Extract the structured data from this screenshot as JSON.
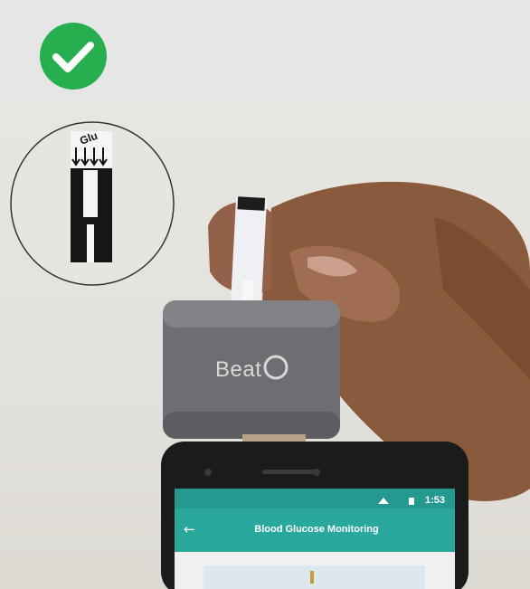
{
  "badge": {
    "icon": "check-icon",
    "color": "#27ae4f"
  },
  "device": {
    "brand": "Beat"
  },
  "strip": {
    "label": "Glu"
  },
  "phone": {
    "status_time": "1:53",
    "app_title": "Blood Glucose Monitoring",
    "back_icon": "back-arrow-icon",
    "header_color": "#2aa89e"
  }
}
